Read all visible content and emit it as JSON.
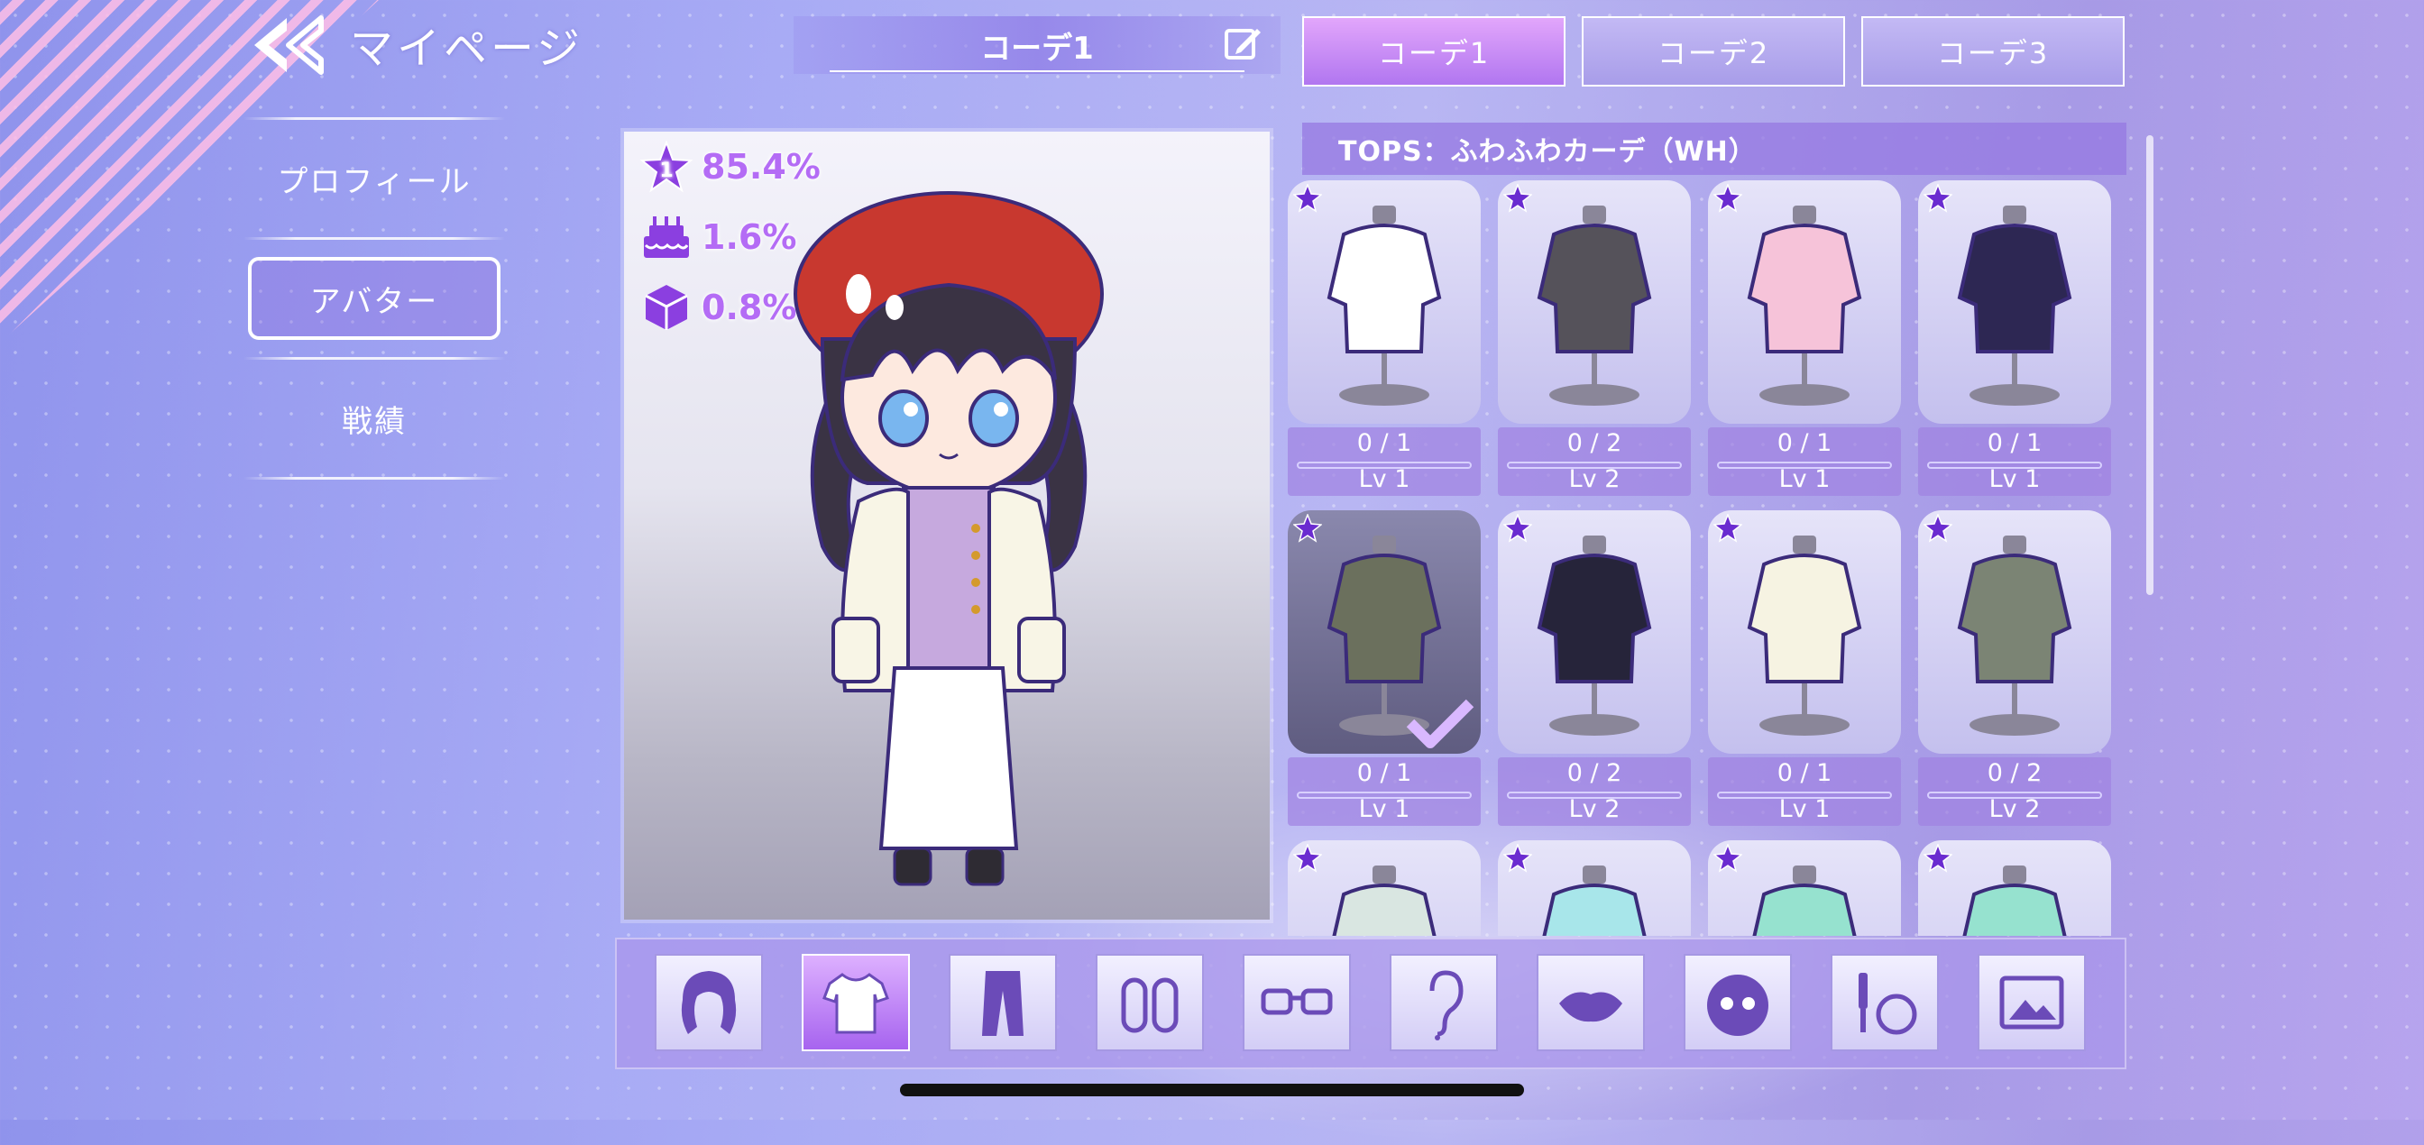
{
  "header": {
    "page_title": "マイページ",
    "coord_name": "コーデ1",
    "tabs": [
      {
        "label": "コーデ1",
        "active": true
      },
      {
        "label": "コーデ2",
        "active": false
      },
      {
        "label": "コーデ3",
        "active": false
      }
    ]
  },
  "menu": {
    "items": [
      {
        "label": "プロフィール",
        "active": false
      },
      {
        "label": "アバター",
        "active": true
      },
      {
        "label": "戦績",
        "active": false
      }
    ]
  },
  "preview": {
    "stats": [
      {
        "icon": "star-rank-icon",
        "badge": "1",
        "value": "85.4%"
      },
      {
        "icon": "cake-icon",
        "value": "1.6%"
      },
      {
        "icon": "box-icon",
        "value": "0.8%"
      }
    ]
  },
  "items_panel": {
    "title": "TOPS：ふわふわカーデ（WH）",
    "items": [
      {
        "icon": "white-tshirt-icon",
        "count": "0 / 1",
        "level": "Lv 1",
        "selected": false
      },
      {
        "icon": "plaid-shirt-icon",
        "count": "0 / 2",
        "level": "Lv 2",
        "selected": false
      },
      {
        "icon": "pink-blouse-icon",
        "count": "0 / 1",
        "level": "Lv 1",
        "selected": false
      },
      {
        "icon": "navy-jacket-icon",
        "count": "0 / 1",
        "level": "Lv 1",
        "selected": false
      },
      {
        "icon": "green-cardigan-icon",
        "count": "0 / 1",
        "level": "Lv 1",
        "selected": true
      },
      {
        "icon": "black-frill-blouse-icon",
        "count": "0 / 2",
        "level": "Lv 2",
        "selected": false
      },
      {
        "icon": "cream-jacket-icon",
        "count": "0 / 1",
        "level": "Lv 1",
        "selected": false
      },
      {
        "icon": "khaki-cardigan-icon",
        "count": "0 / 2",
        "level": "Lv 2",
        "selected": false
      },
      {
        "icon": "knit-sweater-icon"
      },
      {
        "icon": "mint-jacket-icon"
      },
      {
        "icon": "mint-top-icon"
      },
      {
        "icon": "mint-top-icon"
      }
    ]
  },
  "categories": [
    {
      "name": "hair-icon",
      "active": false
    },
    {
      "name": "tshirt-icon",
      "active": true
    },
    {
      "name": "pants-icon",
      "active": false
    },
    {
      "name": "shoes-icon",
      "active": false
    },
    {
      "name": "glasses-icon",
      "active": false
    },
    {
      "name": "ear-icon",
      "active": false
    },
    {
      "name": "lips-icon",
      "active": false
    },
    {
      "name": "face-icon",
      "active": false
    },
    {
      "name": "makeup-icon",
      "active": false
    },
    {
      "name": "background-image-icon",
      "active": false
    }
  ],
  "colors": {
    "accent_purple": "#b46cf5",
    "active_tab": "#c98af6",
    "panel": "#9f88e6"
  }
}
